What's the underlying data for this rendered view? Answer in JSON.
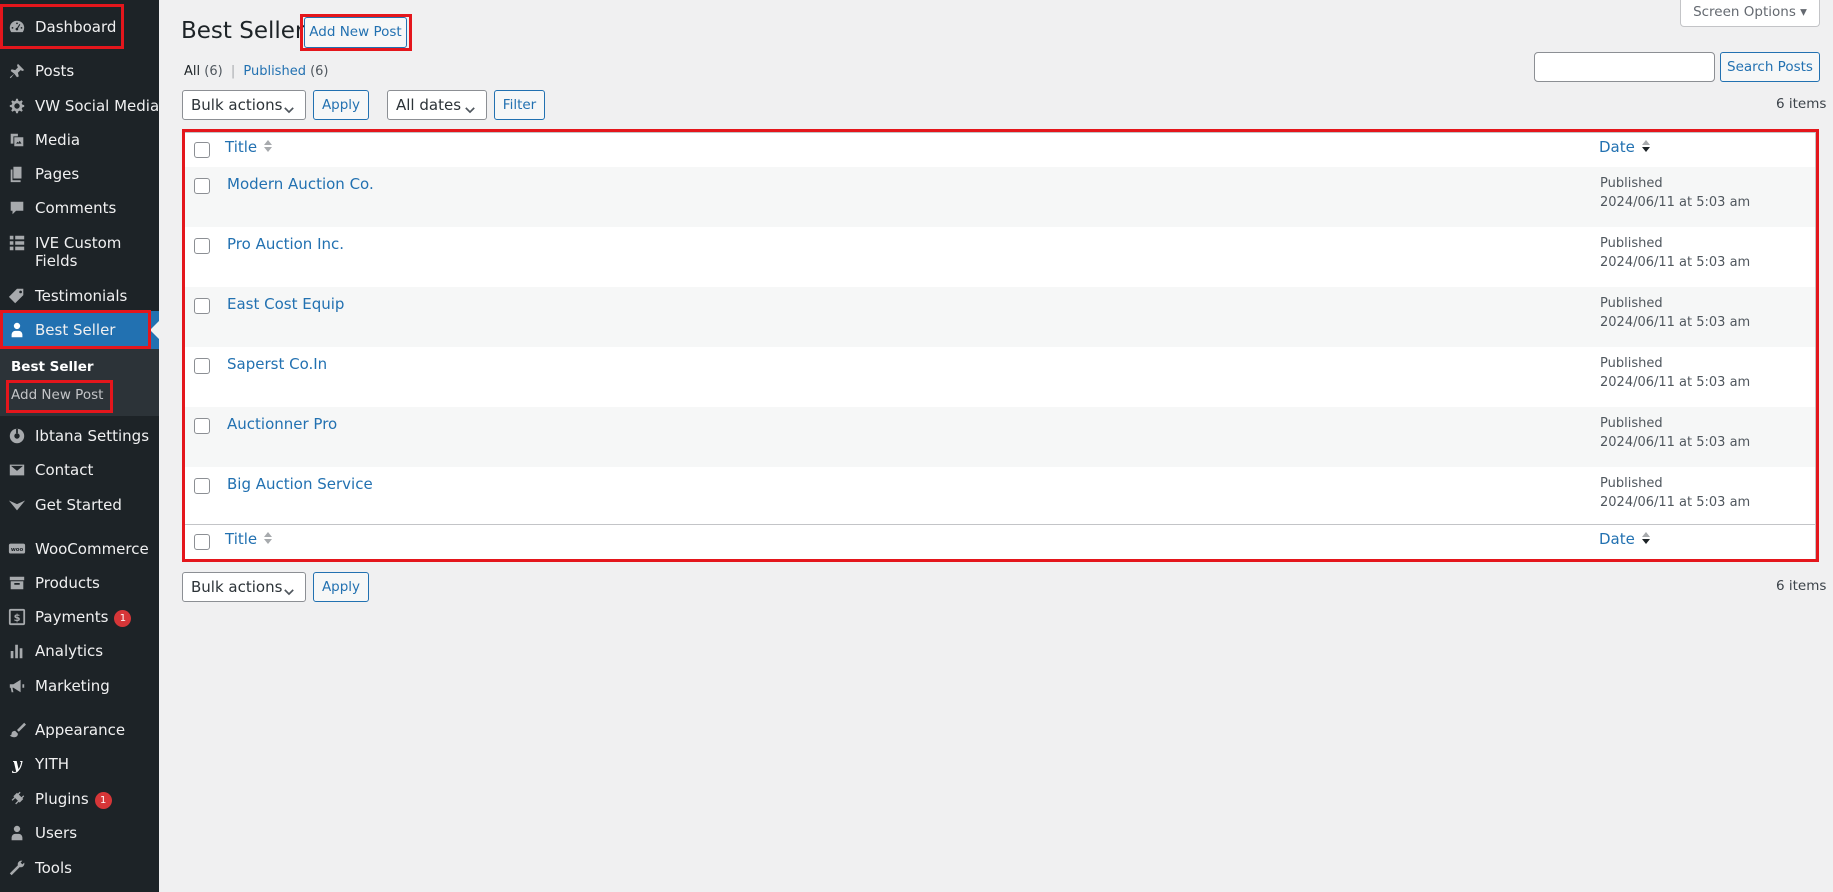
{
  "sidebar": {
    "items": [
      {
        "key": "dashboard",
        "label": "Dashboard",
        "icon": "dashboard-icon"
      },
      {
        "key": "posts",
        "label": "Posts",
        "icon": "pin-icon"
      },
      {
        "key": "vw_social",
        "label": "VW Social Media",
        "icon": "gear-icon"
      },
      {
        "key": "media",
        "label": "Media",
        "icon": "media-icon"
      },
      {
        "key": "pages",
        "label": "Pages",
        "icon": "pages-icon"
      },
      {
        "key": "comments",
        "label": "Comments",
        "icon": "comment-icon"
      },
      {
        "key": "ive_custom",
        "label_line1": "IVE Custom",
        "label_line2": "Fields",
        "icon": "grid-icon"
      },
      {
        "key": "testimonials",
        "label": "Testimonials",
        "icon": "tag-icon"
      },
      {
        "key": "best_seller",
        "label": "Best Seller",
        "icon": "user-icon",
        "active": true
      },
      {
        "key": "ibtana",
        "label": "Ibtana Settings",
        "icon": "ibtana-icon"
      },
      {
        "key": "contact",
        "label": "Contact",
        "icon": "mail-icon"
      },
      {
        "key": "get_started",
        "label": "Get Started",
        "icon": "chevron-icon"
      },
      {
        "key": "woocommerce",
        "label": "WooCommerce",
        "icon": "woo-icon"
      },
      {
        "key": "products",
        "label": "Products",
        "icon": "archive-icon"
      },
      {
        "key": "payments",
        "label": "Payments",
        "icon": "dollar-icon",
        "badge": "1"
      },
      {
        "key": "analytics",
        "label": "Analytics",
        "icon": "bar-chart-icon"
      },
      {
        "key": "marketing",
        "label": "Marketing",
        "icon": "megaphone-icon"
      },
      {
        "key": "appearance",
        "label": "Appearance",
        "icon": "brush-icon"
      },
      {
        "key": "yith",
        "label": "YITH",
        "icon": "yith-icon"
      },
      {
        "key": "plugins",
        "label": "Plugins",
        "icon": "plug-icon",
        "badge": "1"
      },
      {
        "key": "users",
        "label": "Users",
        "icon": "users-icon"
      },
      {
        "key": "tools",
        "label": "Tools",
        "icon": "wrench-icon"
      }
    ],
    "submenu": [
      {
        "label": "Best Seller",
        "current": true
      },
      {
        "label": "Add New Post"
      }
    ]
  },
  "header": {
    "title": "Best Seller",
    "add_new_label": "Add New Post",
    "screen_options_label": "Screen Options ▾"
  },
  "views": {
    "all_label": "All",
    "all_count": "(6)",
    "separator": "|",
    "published_label": "Published",
    "published_count": "(6)"
  },
  "search": {
    "placeholder": "",
    "button_label": "Search Posts"
  },
  "filters": {
    "bulk_actions": "Bulk actions",
    "apply_label": "Apply",
    "dates": "All dates",
    "filter_label": "Filter"
  },
  "items_count": "6 items",
  "table": {
    "col_title": "Title",
    "col_date": "Date",
    "rows": [
      {
        "title": "Modern Auction Co.",
        "status": "Published",
        "date": "2024/06/11 at 5:03 am"
      },
      {
        "title": "Pro Auction Inc.",
        "status": "Published",
        "date": "2024/06/11 at 5:03 am"
      },
      {
        "title": "East Cost Equip",
        "status": "Published",
        "date": "2024/06/11 at 5:03 am"
      },
      {
        "title": "Saperst Co.In",
        "status": "Published",
        "date": "2024/06/11 at 5:03 am"
      },
      {
        "title": "Auctionner Pro",
        "status": "Published",
        "date": "2024/06/11 at 5:03 am"
      },
      {
        "title": "Big Auction Service",
        "status": "Published",
        "date": "2024/06/11 at 5:03 am"
      }
    ]
  },
  "colors": {
    "sidebar_bg": "#1d2327",
    "accent": "#2271b1",
    "highlight": "#e4161c",
    "badge": "#d63638"
  }
}
